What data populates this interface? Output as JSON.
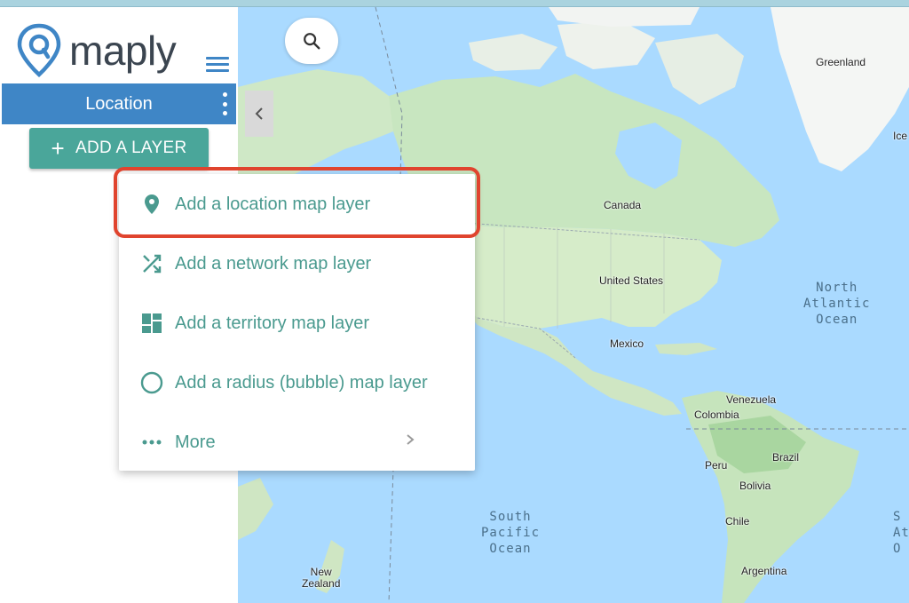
{
  "app": {
    "logo_text": "maply",
    "logo_icon": "map-pin-logo-icon"
  },
  "sidebar": {
    "layer_tab_label": "Location",
    "add_layer_label": "ADD A LAYER",
    "menu_icon": "hamburger-icon"
  },
  "menu": {
    "items": [
      {
        "label": "Add a location map layer",
        "icon": "location-pin-icon"
      },
      {
        "label": "Add a network map layer",
        "icon": "shuffle-icon"
      },
      {
        "label": "Add a territory map layer",
        "icon": "dashboard-icon"
      },
      {
        "label": "Add a radius (bubble) map layer",
        "icon": "circle-outline-icon"
      },
      {
        "label": "More",
        "icon": "more-horizontal-icon"
      }
    ]
  },
  "map": {
    "labels": {
      "greenland": "Greenland",
      "iceland": "Ice",
      "canada": "Canada",
      "united_states": "United States",
      "mexico": "Mexico",
      "venezuela": "Venezuela",
      "colombia": "Colombia",
      "peru": "Peru",
      "brazil": "Brazil",
      "bolivia": "Bolivia",
      "chile": "Chile",
      "argentina": "Argentina",
      "new_zealand": "New\nZealand",
      "north_atlantic": "North\nAtlantic\nOcean",
      "south_pacific": "South\nPacific\nOcean",
      "south_atlantic": "S\nAt\nO"
    }
  },
  "colors": {
    "brand_blue": "#3f86c6",
    "teal": "#4aa69a",
    "highlight_red": "#e0442e",
    "ocean": "#aadaff",
    "land": "#bfe3c0"
  }
}
